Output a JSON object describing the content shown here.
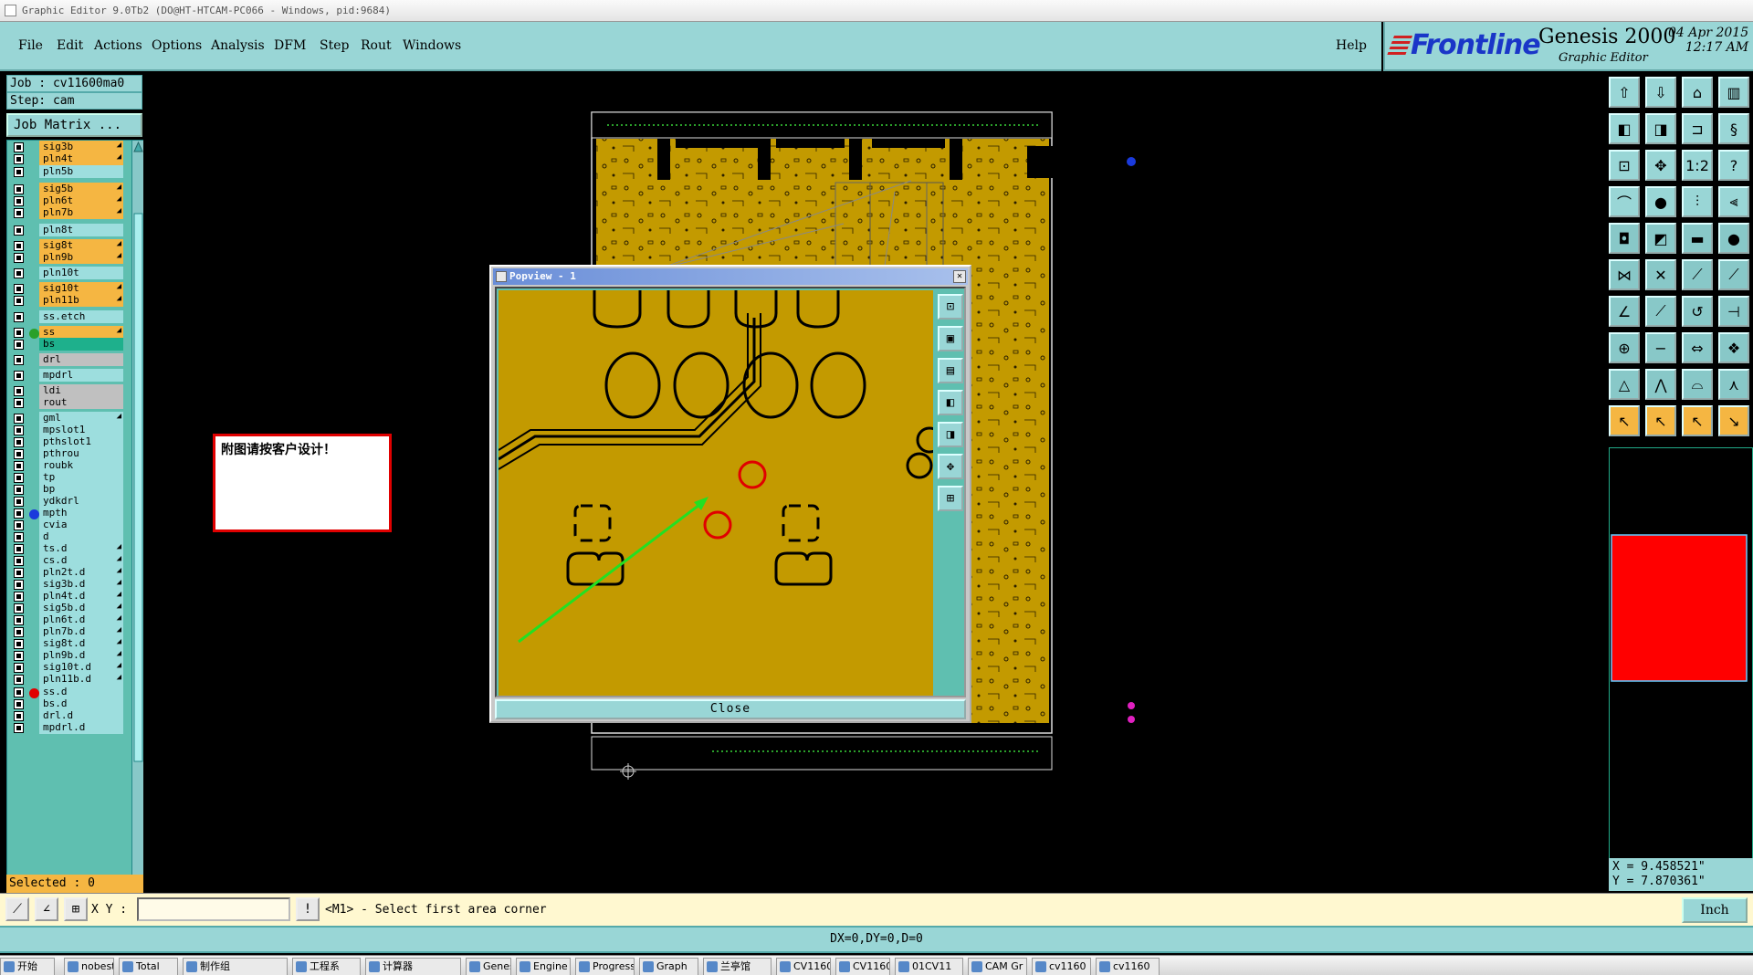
{
  "window": {
    "title": "Graphic Editor 9.0Tb2 (DO@HT-HTCAM-PC066 - Windows, pid:9684)"
  },
  "menu": [
    "File",
    "Edit",
    "Actions",
    "Options",
    "Analysis",
    "DFM",
    "Step",
    "Rout",
    "Windows"
  ],
  "help": "Help",
  "brand": {
    "logo": "Frontline",
    "product": "Genesis 2000",
    "subtitle": "Graphic Editor",
    "date": "04 Apr 2015",
    "time": "12:17 AM"
  },
  "job": {
    "job_line": "Job : cv11600ma0",
    "step_line": "Step: cam",
    "matrix_button": "Job Matrix ..."
  },
  "layers": [
    {
      "name": "sig3b",
      "style": "orange",
      "arrow": true
    },
    {
      "name": "pln4t",
      "style": "orange",
      "arrow": true
    },
    {
      "name": "pln5b",
      "style": "plain"
    },
    {
      "name": "sig5b",
      "style": "orange",
      "arrow": true
    },
    {
      "name": "pln6t",
      "style": "orange",
      "arrow": true
    },
    {
      "name": "pln7b",
      "style": "orange",
      "arrow": true
    },
    {
      "name": "pln8t",
      "style": "plain"
    },
    {
      "name": "sig8t",
      "style": "orange",
      "arrow": true
    },
    {
      "name": "pln9b",
      "style": "orange",
      "arrow": true
    },
    {
      "name": "pln10t",
      "style": "plain"
    },
    {
      "name": "sig10t",
      "style": "orange",
      "arrow": true
    },
    {
      "name": "pln11b",
      "style": "orange",
      "arrow": true
    },
    {
      "name": "ss.etch",
      "style": "plain"
    },
    {
      "name": "ss",
      "style": "orange",
      "arrow": true,
      "dot": "#2aa02a"
    },
    {
      "name": "bs",
      "style": "green"
    },
    {
      "name": "drl",
      "style": "gray"
    },
    {
      "name": "mpdrl",
      "style": "plain"
    },
    {
      "name": "ldi",
      "style": "gray"
    },
    {
      "name": "rout",
      "style": "gray"
    },
    {
      "name": "gml",
      "style": "plain",
      "arrow": true
    },
    {
      "name": "mpslot1",
      "style": "plain"
    },
    {
      "name": "pthslot1",
      "style": "plain"
    },
    {
      "name": "pthrou",
      "style": "plain"
    },
    {
      "name": "roubk",
      "style": "plain"
    },
    {
      "name": "tp",
      "style": "plain"
    },
    {
      "name": "bp",
      "style": "plain"
    },
    {
      "name": "ydkdrl",
      "style": "plain"
    },
    {
      "name": "mpth",
      "style": "plain",
      "dot": "#1a3adc"
    },
    {
      "name": "cvia",
      "style": "plain"
    },
    {
      "name": "d",
      "style": "plain"
    },
    {
      "name": "ts.d",
      "style": "plain",
      "arrow": true
    },
    {
      "name": "cs.d",
      "style": "plain",
      "arrow": true
    },
    {
      "name": "pln2t.d",
      "style": "plain",
      "arrow": true
    },
    {
      "name": "sig3b.d",
      "style": "plain",
      "arrow": true
    },
    {
      "name": "pln4t.d",
      "style": "plain",
      "arrow": true
    },
    {
      "name": "sig5b.d",
      "style": "plain",
      "arrow": true
    },
    {
      "name": "pln6t.d",
      "style": "plain",
      "arrow": true
    },
    {
      "name": "pln7b.d",
      "style": "plain",
      "arrow": true
    },
    {
      "name": "sig8t.d",
      "style": "plain",
      "arrow": true
    },
    {
      "name": "pln9b.d",
      "style": "plain",
      "arrow": true
    },
    {
      "name": "sig10t.d",
      "style": "plain",
      "arrow": true
    },
    {
      "name": "pln11b.d",
      "style": "plain",
      "arrow": true
    },
    {
      "name": "ss.d",
      "style": "plain",
      "dot": "#e00000"
    },
    {
      "name": "bs.d",
      "style": "plain"
    },
    {
      "name": "drl.d",
      "style": "plain"
    },
    {
      "name": "mpdrl.d",
      "style": "plain"
    }
  ],
  "selected": "Selected : 0",
  "note": "附图请按客户设计！",
  "popview": {
    "title": "Popview - 1",
    "close_label": "Close"
  },
  "cmd": {
    "xy_label": "X Y :",
    "xy_value": "",
    "prompt": "<M1> - Select first area corner",
    "unit": "Inch"
  },
  "coords": {
    "x": "X = 9.458521\"",
    "y": "Y = 7.870361\""
  },
  "status": "DX=0,DY=0,D=0",
  "taskbar": [
    "开始",
    "nobest",
    "Total",
    "制作组",
    "工程系",
    "计算器",
    "Genesis",
    "Engine",
    "Progress",
    "Graph",
    "兰亭馆",
    "CV1160",
    "CV1160",
    "01CV11",
    "CAM Gr",
    "cv1160",
    "cv1160"
  ],
  "colors": {
    "menu_bg": "#99d6d6",
    "board": "#c39a00",
    "layer_active": "#f5b642",
    "note_border": "#e00000",
    "minimap": "#ff0000"
  }
}
